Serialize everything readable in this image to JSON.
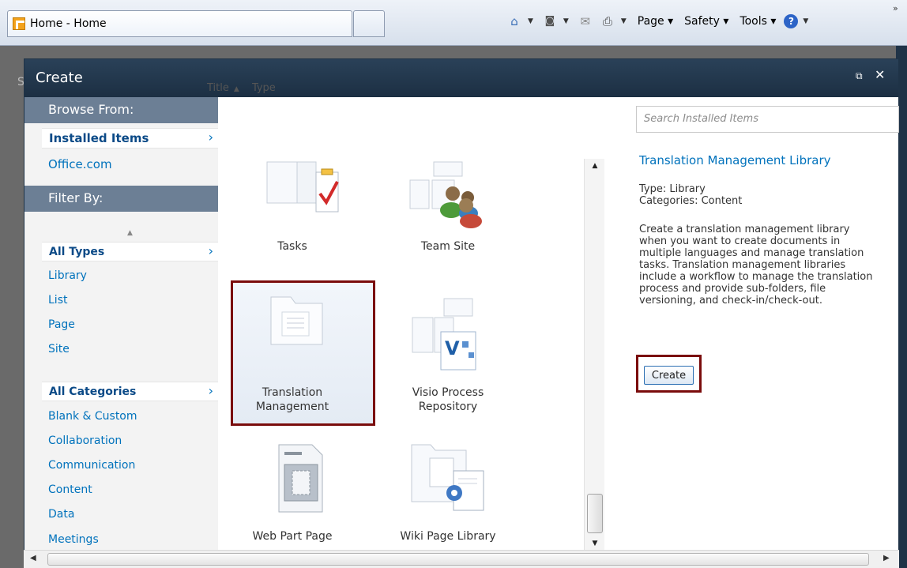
{
  "browser": {
    "tab_title": "Home - Home",
    "menus": [
      "Page",
      "Safety",
      "Tools"
    ],
    "overflow": "»"
  },
  "dialog": {
    "title": "Create",
    "restore": "⧉",
    "close": "✕"
  },
  "nav": {
    "browse_heading": "Browse From:",
    "browse_items": [
      {
        "label": "Installed Items",
        "selected": true
      },
      {
        "label": "Office.com",
        "selected": false
      }
    ],
    "filter_heading": "Filter By:",
    "types": [
      "All Types",
      "Library",
      "List",
      "Page",
      "Site"
    ],
    "categories": [
      "All Categories",
      "Blank & Custom",
      "Collaboration",
      "Communication",
      "Content",
      "Data",
      "Meetings"
    ]
  },
  "gallery": {
    "sort_title": "Title",
    "sort_type": "Type",
    "sort_arrow": "▲",
    "tiles": [
      {
        "label": "Tasks",
        "icon": "tasks-icon"
      },
      {
        "label": "Team Site",
        "icon": "team-site-icon"
      },
      {
        "label": "Translation\nManagement",
        "icon": "translation-management-icon",
        "selected": true
      },
      {
        "label": "Visio Process\nRepository",
        "icon": "visio-process-repository-icon"
      },
      {
        "label": "Web Part Page",
        "icon": "web-part-page-icon"
      },
      {
        "label": "Wiki Page Library",
        "icon": "wiki-page-library-icon"
      }
    ]
  },
  "details": {
    "search_placeholder": "Search Installed Items",
    "title": "Translation Management Library",
    "type_line": "Type: Library",
    "categories_line": "Categories: Content",
    "description": "Create a translation management library when you want to create documents in multiple languages and manage translation tasks. Translation management libraries include a workflow to manage the translation process and provide sub-folders, file versioning, and check-in/check-out.",
    "create_label": "Create"
  },
  "colors": {
    "title_bar": "#1c2f43",
    "nav_heading": "#6c7f95",
    "link": "#0072bc",
    "highlight_border": "#7a0c0c"
  }
}
